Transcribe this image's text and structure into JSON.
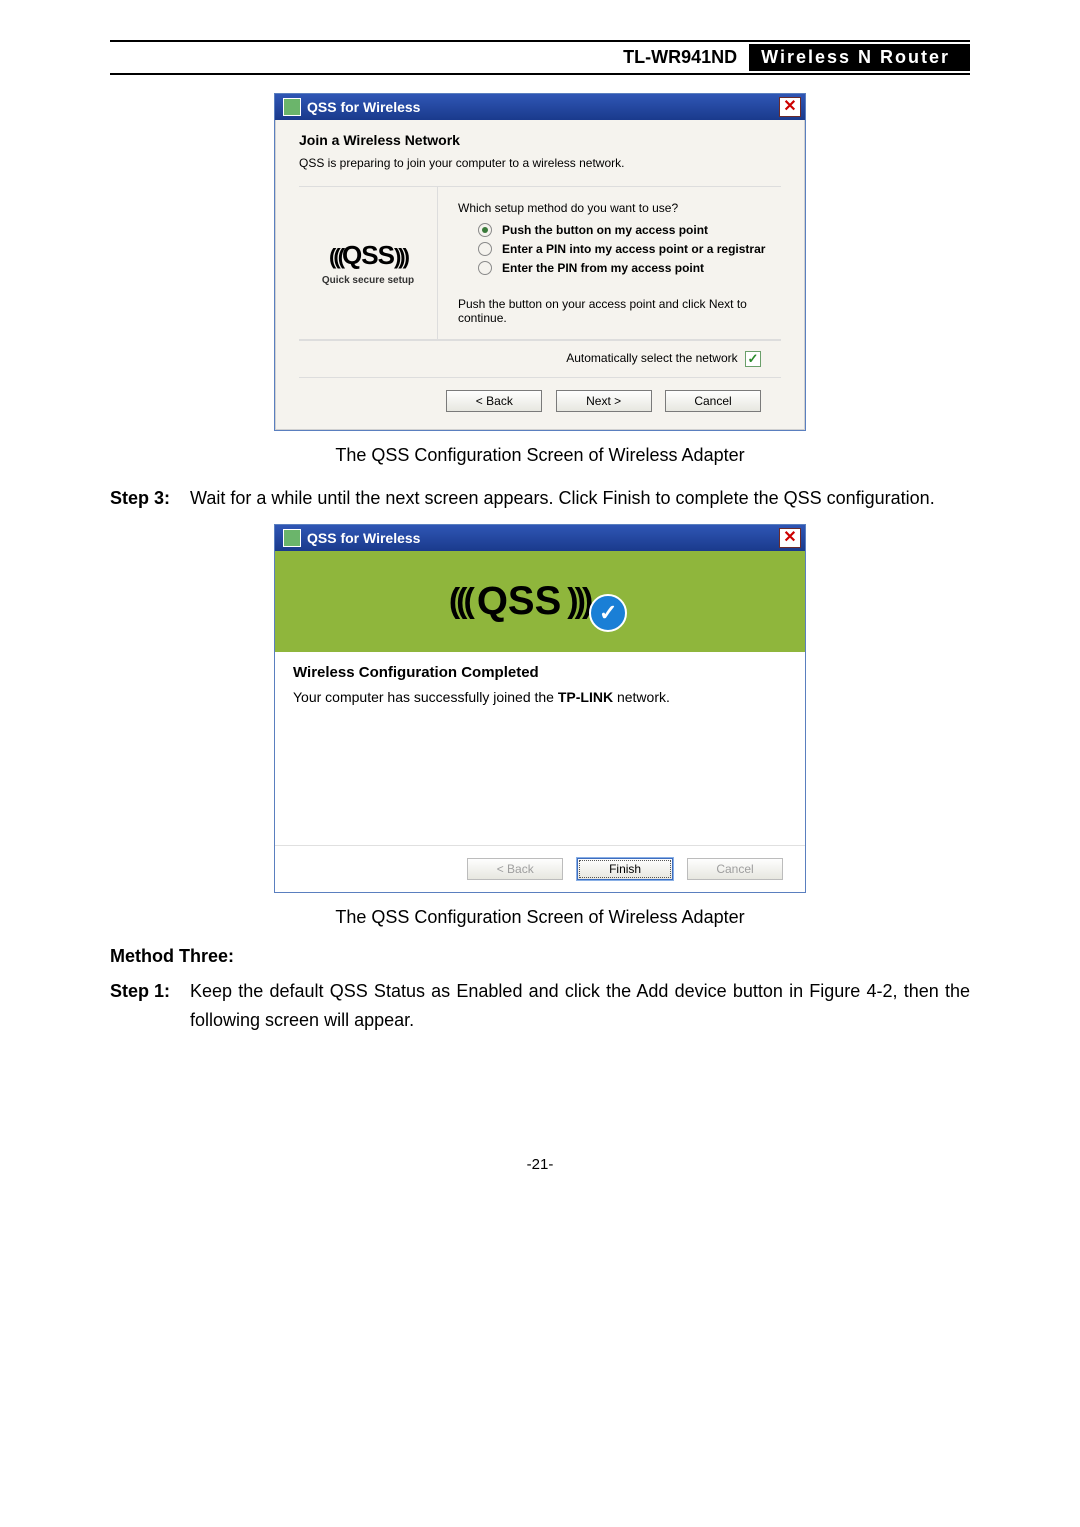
{
  "header": {
    "model": "TL-WR941ND",
    "product": "Wireless  N  Router"
  },
  "dialog1": {
    "title": "QSS for Wireless",
    "heading": "Join a Wireless Network",
    "subtitle": "QSS is preparing to join your computer to a wireless network.",
    "logo_label": "Quick secure setup",
    "question": "Which setup method do you want to use?",
    "options": [
      "Push the button on my access point",
      "Enter a PIN into my access point or a registrar",
      "Enter the PIN from my access point"
    ],
    "instruction": "Push the button on your access point and click Next to continue.",
    "auto_label": "Automatically select the network",
    "back": "< Back",
    "next": "Next >",
    "cancel": "Cancel"
  },
  "caption1": "The QSS Configuration Screen of Wireless Adapter",
  "step3_label": "Step 3:",
  "step3_text_a": "Wait for a while until the next screen appears. Click ",
  "step3_text_b": "Finish",
  "step3_text_c": " to complete the QSS configuration.",
  "dialog2": {
    "title": "QSS for Wireless",
    "heading": "Wireless Configuration Completed",
    "body_a": "Your computer has successfully joined the ",
    "body_b": "TP-LINK",
    "body_c": " network.",
    "back": "< Back",
    "finish": "Finish",
    "cancel": "Cancel"
  },
  "caption2": "The QSS Configuration Screen of Wireless Adapter",
  "method_three": "Method Three:",
  "step1_label": "Step 1:",
  "step1_a": "Keep the default QSS Status as ",
  "step1_b": "Enabled",
  "step1_c": " and click the ",
  "step1_d": "Add device",
  "step1_e": " button in Figure 4-2, then the following screen will appear.",
  "page_num": "-21-"
}
